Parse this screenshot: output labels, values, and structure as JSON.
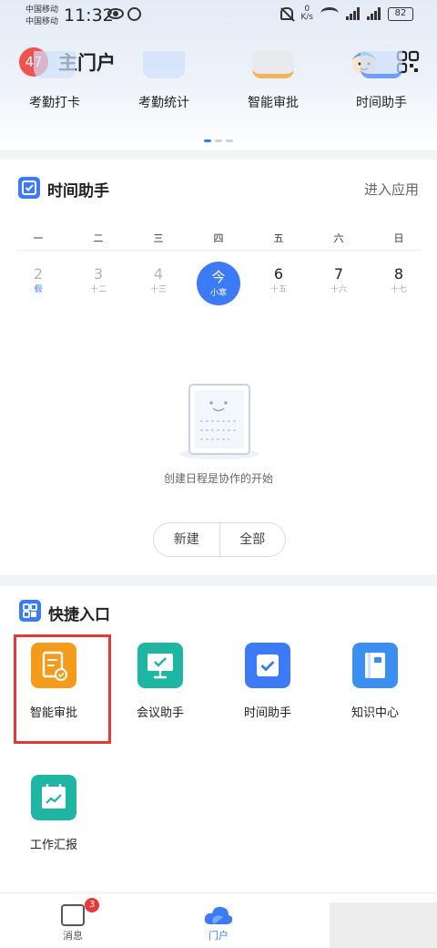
{
  "status_bar": {
    "carrier_1": "中国移动",
    "carrier_2": "中国移动",
    "time": "11:32",
    "net_speed_value": "0",
    "net_speed_unit": "K/s",
    "battery": "82"
  },
  "header": {
    "badge_count": "47",
    "title": "主门户"
  },
  "app_row": [
    {
      "label": "考勤打卡",
      "color": "#4a8ef5"
    },
    {
      "label": "考勤统计",
      "color": "#4a8ef5"
    },
    {
      "label": "智能审批",
      "color": "#f59b1c"
    },
    {
      "label": "时间助手",
      "color": "#4a8ef5"
    }
  ],
  "time_card": {
    "title": "时间助手",
    "enter_label": "进入应用",
    "weekdays": [
      "一",
      "二",
      "三",
      "四",
      "五",
      "六",
      "日"
    ],
    "days": [
      {
        "num": "2",
        "sub": "假"
      },
      {
        "num": "3",
        "sub": "十二"
      },
      {
        "num": "4",
        "sub": "十三"
      },
      {
        "num": "今",
        "sub": "小寒"
      },
      {
        "num": "6",
        "sub": "十五"
      },
      {
        "num": "7",
        "sub": "十六"
      },
      {
        "num": "8",
        "sub": "十七"
      }
    ],
    "empty_text": "创建日程是协作的开始",
    "new_button": "新建",
    "all_button": "全部"
  },
  "quick_card": {
    "title": "快捷入口",
    "items": [
      {
        "label": "智能审批",
        "color": "#f59b1c",
        "icon": "approval-icon"
      },
      {
        "label": "会议助手",
        "color": "#1fb5a3",
        "icon": "meeting-icon"
      },
      {
        "label": "时间助手",
        "color": "#3d7bf6",
        "icon": "time-assistant-icon"
      },
      {
        "label": "知识中心",
        "color": "#3a8ff0",
        "icon": "knowledge-icon"
      },
      {
        "label": "工作汇报",
        "color": "#1fb5a3",
        "icon": "work-report-icon"
      }
    ]
  },
  "bottom_nav": {
    "messages_label": "消息",
    "messages_badge": "3",
    "portal_label": "门户",
    "active_color": "#3d7bf6"
  }
}
